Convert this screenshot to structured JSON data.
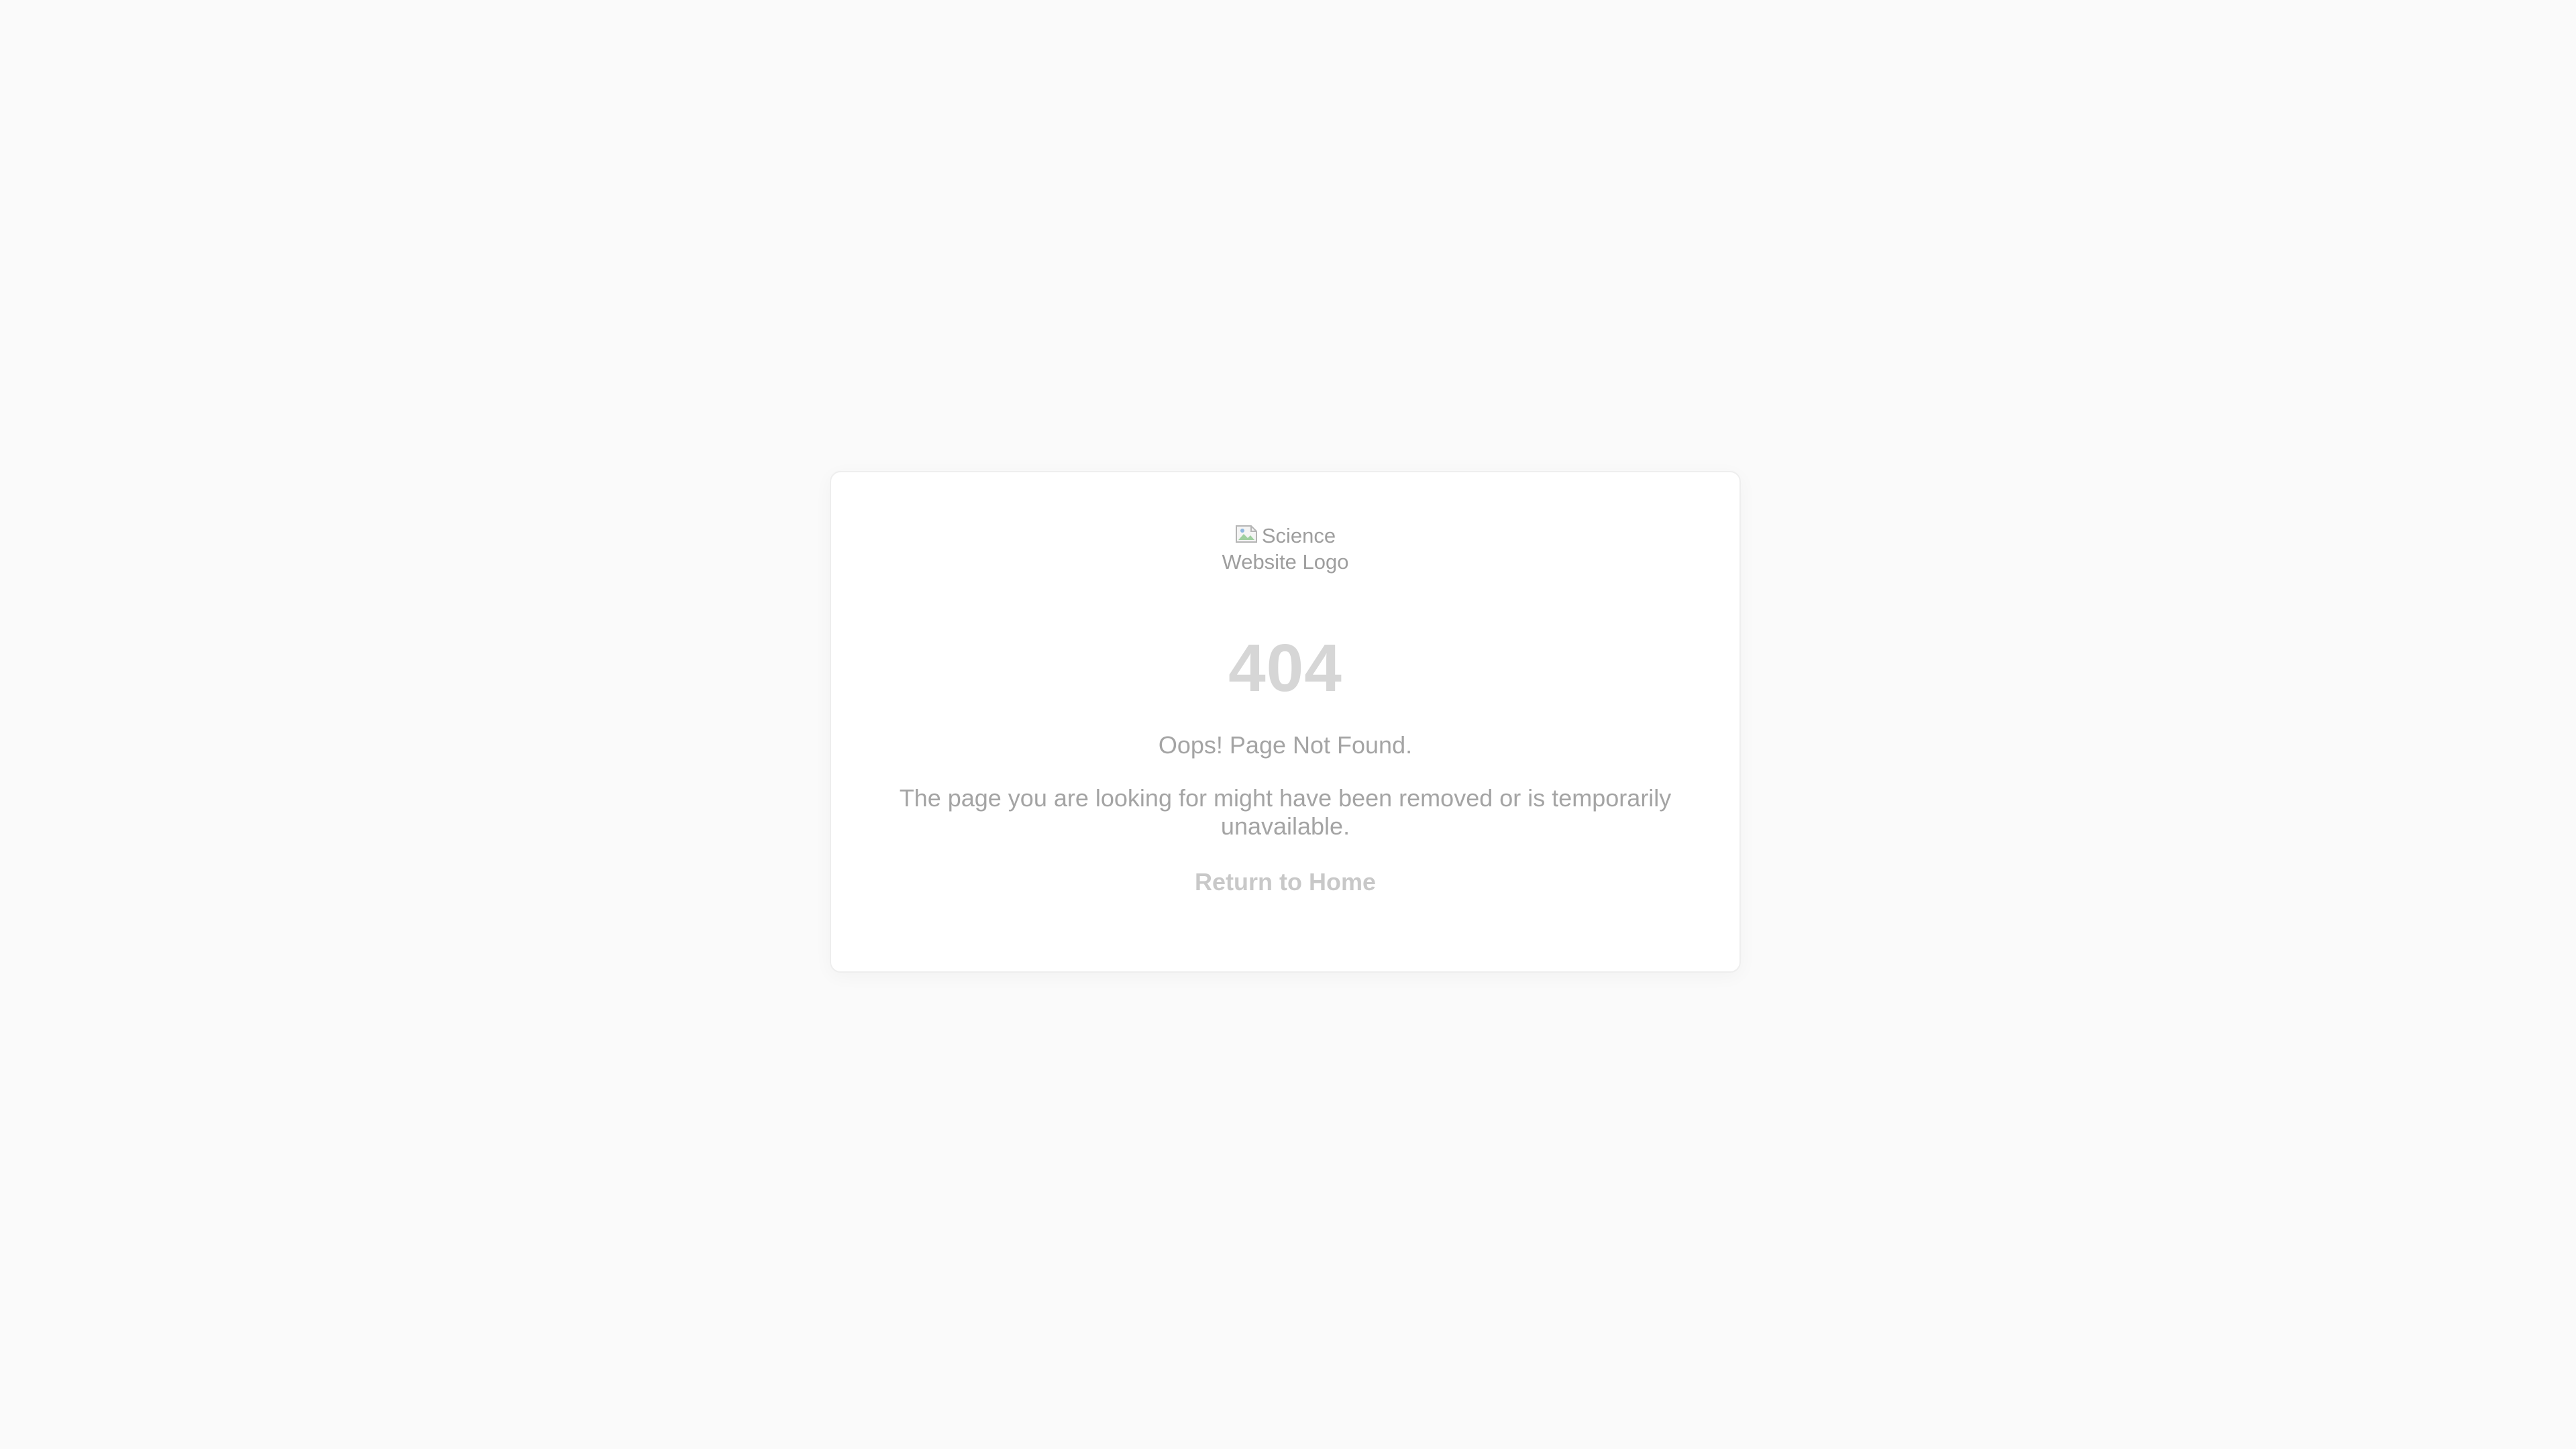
{
  "error_card": {
    "logo": {
      "alt_text": "Science Website Logo",
      "icon": "broken-image-icon"
    },
    "code": "404",
    "headline": "Oops! Page Not Found.",
    "message": "The page you are looking for might have been removed or is temporarily unavailable.",
    "home_link_label": "Return to Home"
  },
  "colors": {
    "background": "#fafafa",
    "card": "#ffffff",
    "code_text": "#d6d6d6",
    "body_text": "#a4a4a4",
    "link_text": "#c8c8c8"
  }
}
